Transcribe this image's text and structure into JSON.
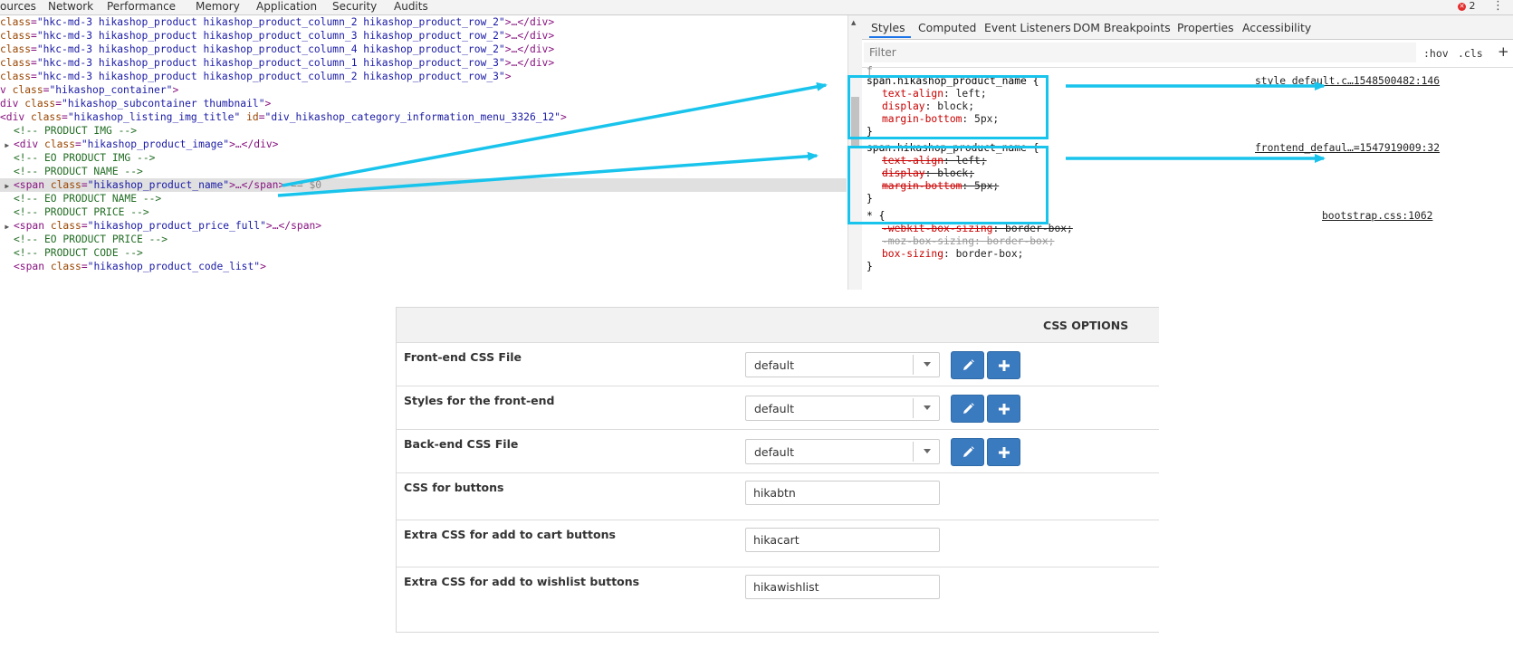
{
  "devtools": {
    "tabs": [
      "ources",
      "Network",
      "Performance",
      "Memory",
      "Application",
      "Security",
      "Audits"
    ],
    "error_count": "2",
    "kebab_glyph": "⋮",
    "dom_lines": [
      {
        "indent": "",
        "tri": "",
        "kind": "html",
        "parts": [
          [
            "attr",
            "class"
          ],
          [
            "tag",
            "="
          ],
          [
            "val",
            "\"hkc-md-3 hikashop_product hikashop_product_column_2 hikashop_product_row_2\""
          ],
          [
            "tag",
            ">…</div>"
          ]
        ]
      },
      {
        "indent": "",
        "tri": "",
        "kind": "html",
        "parts": [
          [
            "attr",
            "class"
          ],
          [
            "tag",
            "="
          ],
          [
            "val",
            "\"hkc-md-3 hikashop_product hikashop_product_column_3 hikashop_product_row_2\""
          ],
          [
            "tag",
            ">…</div>"
          ]
        ]
      },
      {
        "indent": "",
        "tri": "",
        "kind": "html",
        "parts": [
          [
            "attr",
            "class"
          ],
          [
            "tag",
            "="
          ],
          [
            "val",
            "\"hkc-md-3 hikashop_product hikashop_product_column_4 hikashop_product_row_2\""
          ],
          [
            "tag",
            ">…</div>"
          ]
        ]
      },
      {
        "indent": "",
        "tri": "",
        "kind": "html",
        "parts": [
          [
            "attr",
            "class"
          ],
          [
            "tag",
            "="
          ],
          [
            "val",
            "\"hkc-md-3 hikashop_product hikashop_product_column_1 hikashop_product_row_3\""
          ],
          [
            "tag",
            ">…</div>"
          ]
        ]
      },
      {
        "indent": "",
        "tri": "",
        "kind": "html",
        "parts": [
          [
            "attr",
            "class"
          ],
          [
            "tag",
            "="
          ],
          [
            "val",
            "\"hkc-md-3 hikashop_product hikashop_product_column_2 hikashop_product_row_3\""
          ],
          [
            "tag",
            ">"
          ]
        ]
      },
      {
        "indent": "",
        "tri": "",
        "kind": "html",
        "parts": [
          [
            "tag",
            "v "
          ],
          [
            "attr",
            "class"
          ],
          [
            "tag",
            "="
          ],
          [
            "val",
            "\"hikashop_container\""
          ],
          [
            "tag",
            ">"
          ]
        ]
      },
      {
        "indent": "",
        "tri": "",
        "kind": "html",
        "parts": [
          [
            "tag",
            "div "
          ],
          [
            "attr",
            "class"
          ],
          [
            "tag",
            "="
          ],
          [
            "val",
            "\"hikashop_subcontainer thumbnail\""
          ],
          [
            "tag",
            ">"
          ]
        ]
      },
      {
        "indent": "",
        "tri": "",
        "kind": "html",
        "parts": [
          [
            "tag",
            "<div "
          ],
          [
            "attr",
            "class"
          ],
          [
            "tag",
            "="
          ],
          [
            "val",
            "\"hikashop_listing_img_title\""
          ],
          [
            "tag",
            " "
          ],
          [
            "attr",
            "id"
          ],
          [
            "tag",
            "="
          ],
          [
            "val",
            "\"div_hikashop_category_information_menu_3326_12\""
          ],
          [
            "tag",
            ">"
          ]
        ]
      },
      {
        "indent": "  ",
        "tri": "",
        "kind": "cmt",
        "parts": [
          [
            "cmt",
            "<!-- PRODUCT IMG -->"
          ]
        ]
      },
      {
        "indent": "",
        "tri": "▶",
        "kind": "html",
        "parts": [
          [
            "tag",
            "<div "
          ],
          [
            "attr",
            "class"
          ],
          [
            "tag",
            "="
          ],
          [
            "val",
            "\"hikashop_product_image\""
          ],
          [
            "tag",
            ">…</div>"
          ]
        ]
      },
      {
        "indent": "  ",
        "tri": "",
        "kind": "cmt",
        "parts": [
          [
            "cmt",
            "<!-- EO PRODUCT IMG -->"
          ]
        ]
      },
      {
        "indent": "  ",
        "tri": "",
        "kind": "cmt",
        "parts": [
          [
            "cmt",
            "<!-- PRODUCT NAME -->"
          ]
        ]
      },
      {
        "indent": "",
        "tri": "▶",
        "kind": "html",
        "sel": true,
        "parts": [
          [
            "tag",
            "<span "
          ],
          [
            "attr",
            "class"
          ],
          [
            "tag",
            "="
          ],
          [
            "val",
            "\"hikashop_product_name\""
          ],
          [
            "tag",
            ">…</span>"
          ],
          [
            "dim",
            " == $0"
          ]
        ]
      },
      {
        "indent": "  ",
        "tri": "",
        "kind": "cmt",
        "parts": [
          [
            "cmt",
            "<!-- EO PRODUCT NAME -->"
          ]
        ]
      },
      {
        "indent": "  ",
        "tri": "",
        "kind": "cmt",
        "parts": [
          [
            "cmt",
            "<!-- PRODUCT PRICE -->"
          ]
        ]
      },
      {
        "indent": "",
        "tri": "▶",
        "kind": "html",
        "parts": [
          [
            "tag",
            "<span "
          ],
          [
            "attr",
            "class"
          ],
          [
            "tag",
            "="
          ],
          [
            "val",
            "\"hikashop_product_price_full\""
          ],
          [
            "tag",
            ">…</span>"
          ]
        ]
      },
      {
        "indent": "  ",
        "tri": "",
        "kind": "cmt",
        "parts": [
          [
            "cmt",
            "<!-- EO PRODUCT PRICE -->"
          ]
        ]
      },
      {
        "indent": "  ",
        "tri": "",
        "kind": "cmt",
        "parts": [
          [
            "cmt",
            "<!-- PRODUCT CODE -->"
          ]
        ]
      },
      {
        "indent": "  ",
        "tri": "",
        "kind": "html",
        "parts": [
          [
            "tag",
            "<span "
          ],
          [
            "attr",
            "class"
          ],
          [
            "tag",
            "="
          ],
          [
            "val",
            "\"hikashop_product_code_list\""
          ],
          [
            "tag",
            ">"
          ]
        ]
      }
    ],
    "styles": {
      "subtabs": [
        "Styles",
        "Computed",
        "Event Listeners",
        "DOM Breakpoints",
        "Properties",
        "Accessibility"
      ],
      "filter_placeholder": "Filter",
      "hov": ":hov",
      "cls": ".cls",
      "add": "+",
      "rule1": {
        "selector": "span.hikashop_product_name {",
        "decls": [
          [
            "text-align",
            "left"
          ],
          [
            "display",
            "block"
          ],
          [
            "margin-bottom",
            "5px"
          ]
        ],
        "close": "}",
        "source": "style_default.c…1548500482:146"
      },
      "rule2": {
        "selector": "span.hikashop_product_name {",
        "decls": [
          [
            "text-align",
            "left"
          ],
          [
            "display",
            "block"
          ],
          [
            "margin-bottom",
            "5px"
          ]
        ],
        "close": "}",
        "source": "frontend_defaul…=1547919009:32"
      },
      "rule3": {
        "selector": "* {",
        "decls": [
          [
            "-webkit-box-sizing",
            "border-box"
          ],
          [
            "-moz-box-sizing",
            "border-box"
          ],
          [
            "box-sizing",
            "border-box"
          ]
        ],
        "close": "}",
        "source": "bootstrap.css:1062"
      }
    }
  },
  "options": {
    "title": "CSS OPTIONS",
    "rows": [
      {
        "label": "Front-end CSS File",
        "type": "select",
        "value": "default"
      },
      {
        "label": "Styles for the front-end",
        "type": "select",
        "value": "default"
      },
      {
        "label": "Back-end CSS File",
        "type": "select",
        "value": "default"
      },
      {
        "label": "CSS for buttons",
        "type": "input",
        "value": "hikabtn"
      },
      {
        "label": "Extra CSS for add to cart buttons",
        "type": "input",
        "value": "hikacart"
      },
      {
        "label": "Extra CSS for add to wishlist buttons",
        "type": "input",
        "value": "hikawishlist"
      }
    ]
  },
  "colors": {
    "highlight": "#19c4ec",
    "button_blue": "#3a7abf"
  }
}
